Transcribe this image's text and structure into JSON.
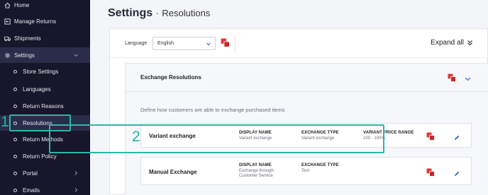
{
  "sidebar": {
    "items": [
      {
        "label": "Home",
        "icon": "home-icon"
      },
      {
        "label": "Manage Returns",
        "icon": "returns-icon"
      },
      {
        "label": "Shipments",
        "icon": "truck-icon"
      },
      {
        "label": "Settings",
        "icon": "gear-icon"
      },
      {
        "label": "Store Settings"
      },
      {
        "label": "Languages"
      },
      {
        "label": "Return Reasons"
      },
      {
        "label": "Resolutions"
      },
      {
        "label": "Return Methods"
      },
      {
        "label": "Return Policy"
      },
      {
        "label": "Portal"
      },
      {
        "label": "Emails"
      }
    ]
  },
  "annotations": {
    "step1": "1",
    "step2": "2"
  },
  "page": {
    "title": "Settings",
    "separator": "·",
    "subtitle": "Resolutions"
  },
  "toolbar": {
    "language_label": "Language",
    "language_value": "English",
    "expand_all": "Expand all"
  },
  "section": {
    "title": "Exchange Resolutions",
    "description": "Define how customers are able to exchange purchased items",
    "rows": [
      {
        "name": "Variant exchange",
        "display_name_header": "DISPLAY NAME",
        "display_name": "Variant exchange",
        "exchange_type_header": "EXCHANGE TYPE",
        "exchange_type": "Variant exchange",
        "price_range_header": "VARIANT PRICE RANGE",
        "price_range": "100 - 100%"
      },
      {
        "name": "Manual Exchange",
        "display_name_header": "DISPLAY NAME",
        "display_name_line1": "Exchange through",
        "display_name_line2": "Customer Service",
        "exchange_type_header": "EXCHANGE TYPE",
        "exchange_type": "Text"
      }
    ]
  },
  "colors": {
    "sidebar_bg": "#17162a",
    "highlight": "#2ab7a6",
    "accent_blue": "#3b5bdb",
    "translate_red": "#e03a3a"
  }
}
